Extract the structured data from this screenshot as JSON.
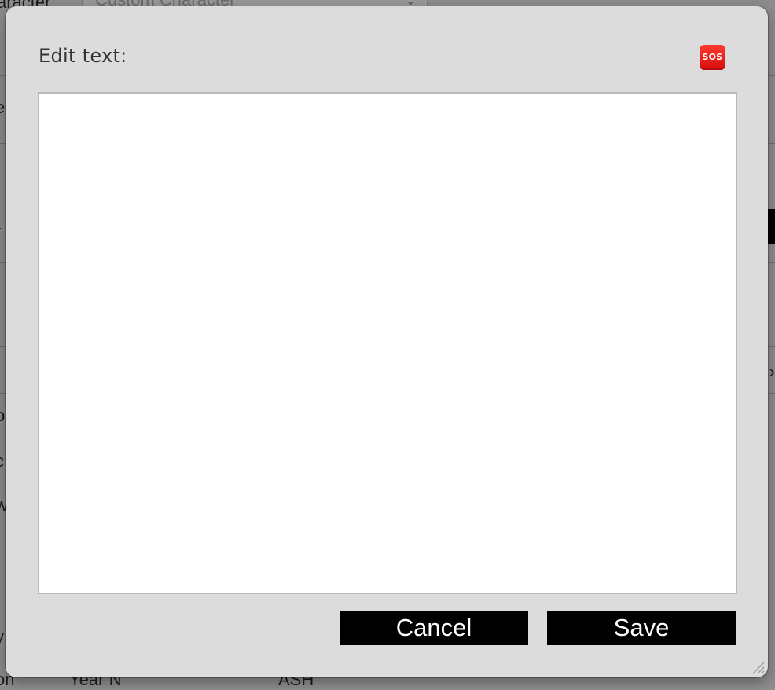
{
  "background": {
    "select_value": "Custom Character",
    "left_labels": [
      "aracter",
      "t",
      "e",
      "i",
      "r",
      "t",
      "b",
      "c",
      "w",
      "y",
      "on"
    ],
    "bottom_texts": [
      "Year N",
      "ASH"
    ]
  },
  "dialog": {
    "title": "Edit text:",
    "sos_icon_text": "SOS",
    "textarea_value": "",
    "cancel_label": "Cancel",
    "save_label": "Save"
  },
  "colors": {
    "dialog_bg": "#dcdcdc",
    "button_bg": "#000000",
    "button_text": "#ffffff",
    "sos_red": "#e01b16"
  }
}
